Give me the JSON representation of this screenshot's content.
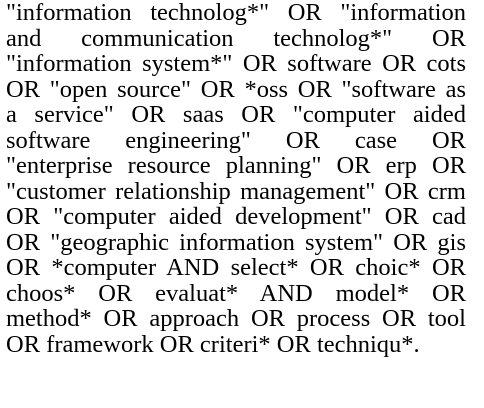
{
  "query": {
    "lines": [
      "\"information technolog*\" OR \"information",
      "and communication technolog*\" OR",
      "\"information system*\" OR software OR cots",
      "OR \"open source\" OR *oss OR \"software as",
      "a service\" OR saas OR \"computer aided",
      "software engineering\" OR case OR",
      "\"enterprise resource planning\" OR erp OR",
      "\"customer relationship management\" OR crm",
      "OR \"computer aided development\" OR cad",
      "OR \"geographic information system\" OR gis",
      "OR *computer AND select* OR choic* OR",
      "choos* OR evaluat* AND model* OR",
      "method* OR approach OR process OR tool",
      "OR framework OR criteri* OR techniqu*."
    ]
  }
}
